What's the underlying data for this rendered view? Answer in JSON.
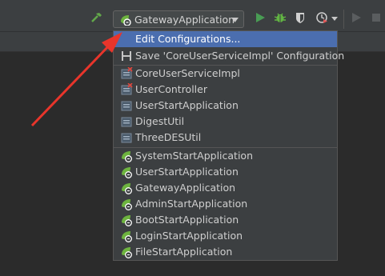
{
  "toolbar": {
    "run_config_label": "GatewayApplication",
    "icons": [
      "build-hammer-icon",
      "run-icon",
      "debug-icon",
      "coverage-icon",
      "profile-icon",
      "stop-icon"
    ]
  },
  "menu": {
    "edit_configurations": "Edit Configurations...",
    "save_configuration": "Save 'CoreUserServiceImpl' Configuration",
    "temporary_configs": [
      "CoreUserServiceImpl",
      "UserController"
    ],
    "app_configs": [
      "UserStartApplication",
      "DigestUtil",
      "ThreeDESUtil"
    ],
    "spring_boot_configs": [
      "SystemStartApplication",
      "UserStartApplication",
      "GatewayApplication",
      "AdminStartApplication",
      "BootStartApplication",
      "LoginStartApplication",
      "FileStartApplication"
    ]
  },
  "colors": {
    "selection": "#4b6eaf",
    "arrow": "#e8352b",
    "run_green": "#499c54",
    "spring_green": "#6db33f"
  }
}
